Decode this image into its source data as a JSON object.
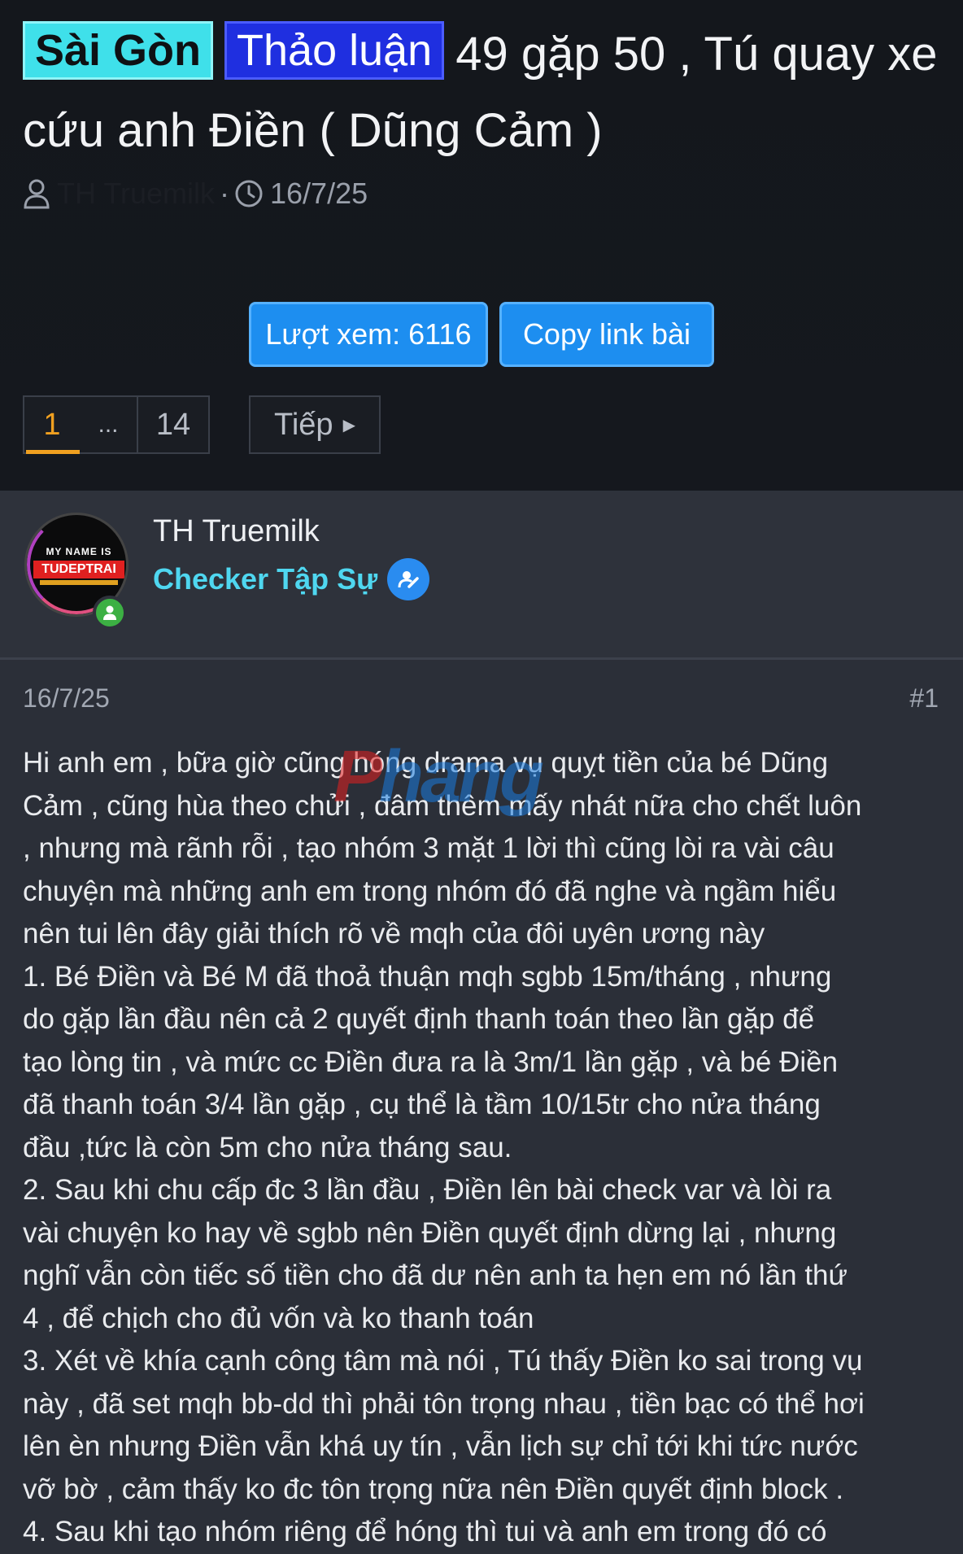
{
  "thread": {
    "prefix_location": "Sài Gòn",
    "prefix_category": "Thảo luận",
    "title": "49 gặp 50 , Tú quay xe cứu anh Điền ( Dũng Cảm )",
    "author": "TH Truemilk",
    "separator": "·",
    "date": "16/7/25"
  },
  "actions": {
    "views_label": "Lượt xem: 6116",
    "copy_link_label": "Copy link bài"
  },
  "pagination": {
    "current": "1",
    "ellipsis": "...",
    "last": "14",
    "next_label": "Tiếp"
  },
  "author_card": {
    "avatar_line1": "MY NAME IS",
    "avatar_line2": "TUDEPTRAI",
    "name": "TH Truemilk",
    "user_title": "Checker Tập Sự"
  },
  "post": {
    "date": "16/7/25",
    "number": "#1",
    "watermark": "Phang",
    "lines": [
      "Hi anh em , bữa giờ cũng hóng drama vụ quỵt tiền của bé Dũng",
      "Cảm , cũng hùa theo chửi , đâm thêm mấy nhát nữa cho chết luôn",
      ", nhưng mà rãnh rỗi , tạo nhóm 3 mặt 1 lời thì cũng lòi ra vài câu",
      "chuyện mà những anh em trong nhóm đó đã nghe và ngầm hiểu",
      "nên tui lên đây giải thích rõ về mqh của đôi uyên ương này",
      "1. Bé Điền và Bé M đã thoả thuận mqh sgbb 15m/tháng , nhưng",
      "do gặp lần đầu nên cả 2 quyết định thanh toán theo lần gặp để",
      "tạo lòng tin , và mức cc Điền đưa ra là 3m/1 lần gặp , và bé Điền",
      "đã thanh toán 3/4 lần gặp , cụ thể là tầm 10/15tr cho nửa tháng",
      "đầu ,tức là còn 5m cho nửa tháng sau.",
      "2. Sau khi chu cấp đc 3 lần đầu , Điền lên bài check var và lòi ra",
      "vài chuyện ko hay về sgbb nên Điền quyết định dừng lại , nhưng",
      "nghĩ vẫn còn tiếc số tiền cho đã dư nên anh ta hẹn em nó lần thứ",
      "4 , để chịch cho đủ vốn và ko thanh toán",
      "3. Xét về khía cạnh công tâm mà nói , Tú thấy Điền ko sai trong vụ",
      "này , đã set mqh bb-dd thì phải tôn trọng nhau , tiền bạc có thể hơi",
      "lên èn nhưng Điền vẫn khá uy tín , vẫn lịch sự chỉ tới khi tức nước",
      "vỡ bờ , cảm thấy ko đc tôn trọng nữa nên Điền quyết định block .",
      "4. Sau khi tạo nhóm riêng để hóng thì tui và anh em trong đó có"
    ]
  },
  "colors": {
    "accent_blue": "#1d8ef0",
    "prefix_cyan": "#3fe0ea",
    "prefix_blue": "#1f2fe0",
    "user_title": "#4fd7f0",
    "pager_active": "#f0a020",
    "online": "#3cb043"
  }
}
